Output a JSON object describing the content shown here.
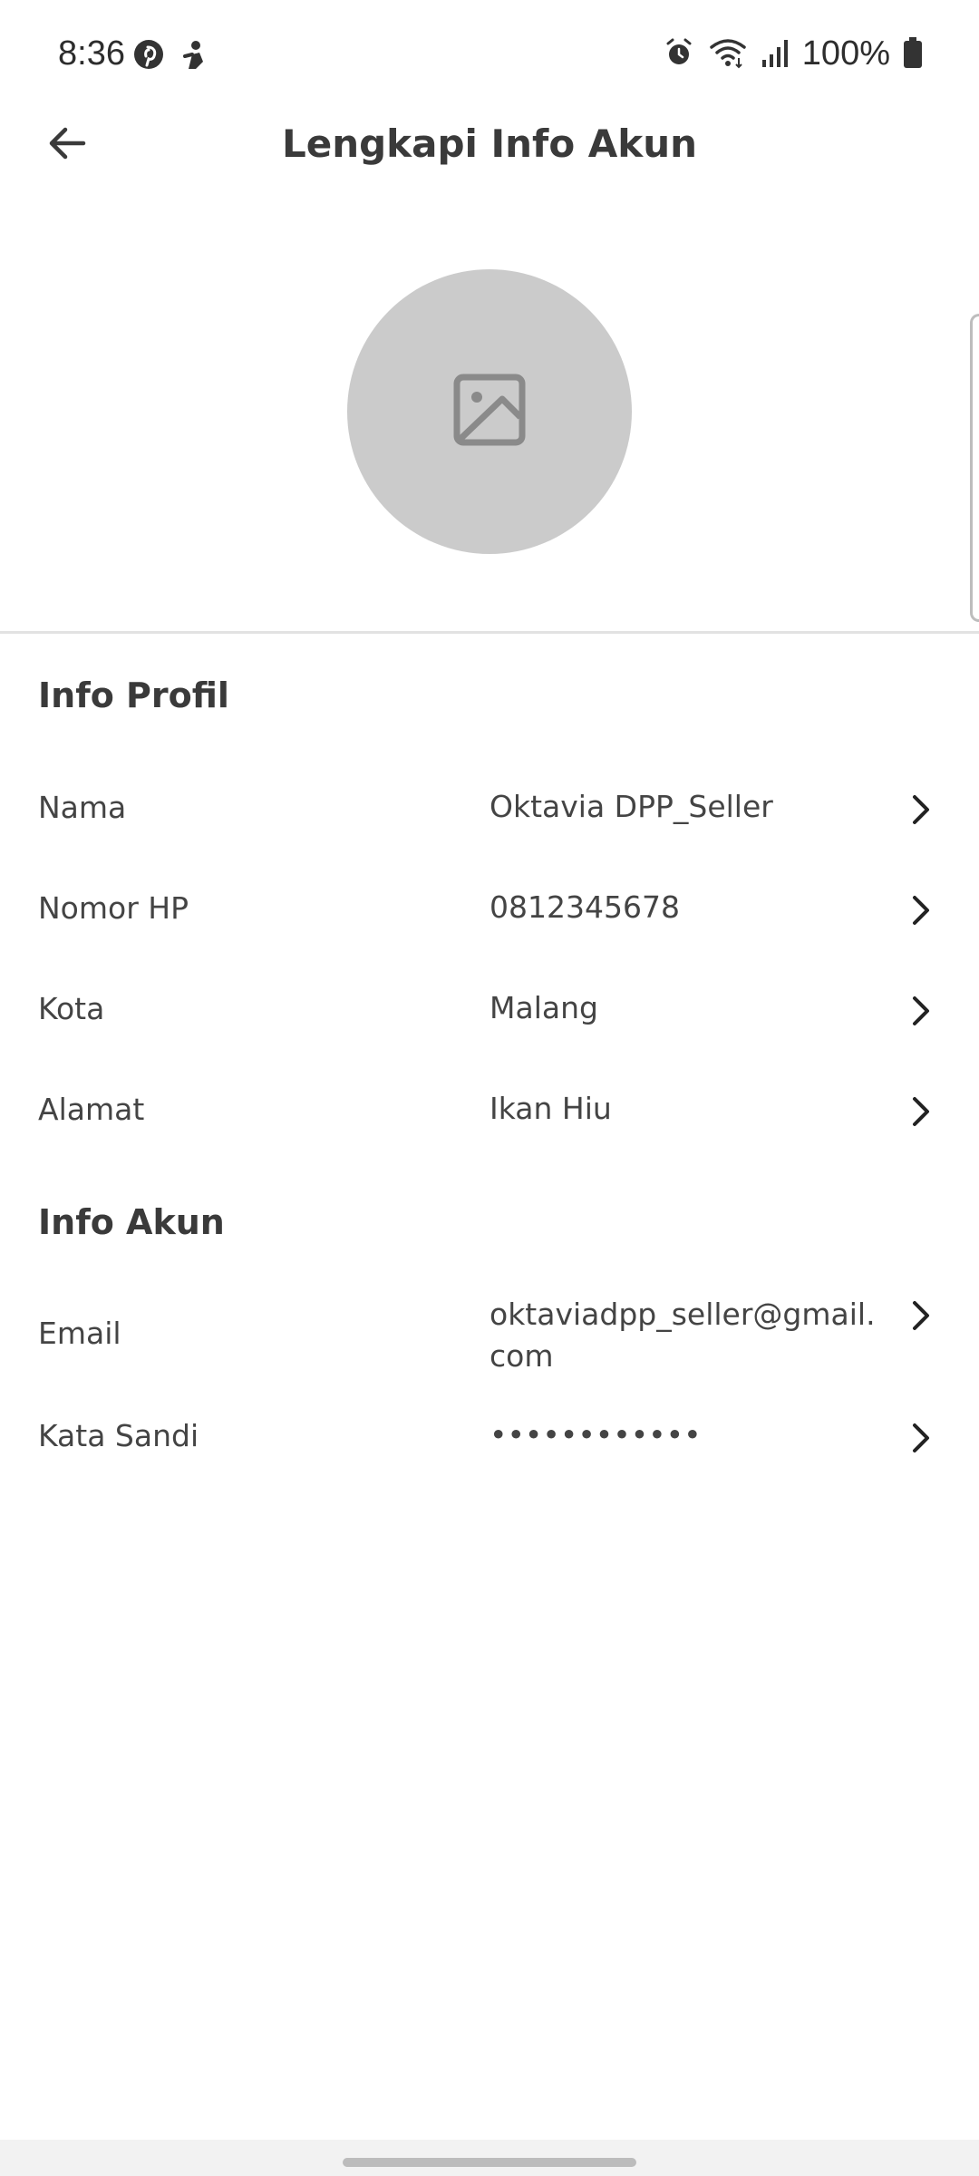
{
  "status_bar": {
    "time": "8:36",
    "battery": "100%",
    "icons": [
      "pinterest-icon",
      "app-notification-icon",
      "alarm-icon",
      "wifi-icon",
      "signal-icon",
      "battery-icon"
    ]
  },
  "header": {
    "title": "Lengkapi Info Akun",
    "back_icon": "arrow-left-icon"
  },
  "avatar": {
    "placeholder_icon": "image-placeholder-icon"
  },
  "profile_section": {
    "title": "Info Profil",
    "rows": [
      {
        "label": "Nama",
        "value": "Oktavia DPP_Seller"
      },
      {
        "label": "Nomor HP",
        "value": "0812345678"
      },
      {
        "label": "Kota",
        "value": "Malang"
      },
      {
        "label": "Alamat",
        "value": "Ikan Hiu"
      }
    ]
  },
  "account_section": {
    "title": "Info Akun",
    "rows": [
      {
        "label": "Email",
        "value": "oktaviadpp_seller@gmail.com"
      },
      {
        "label": "Kata Sandi",
        "value": "••••••••••••"
      }
    ]
  },
  "colors": {
    "text": "#3a3a3a",
    "avatar_bg": "#cbcbcb",
    "divider": "#e2e2e2"
  }
}
